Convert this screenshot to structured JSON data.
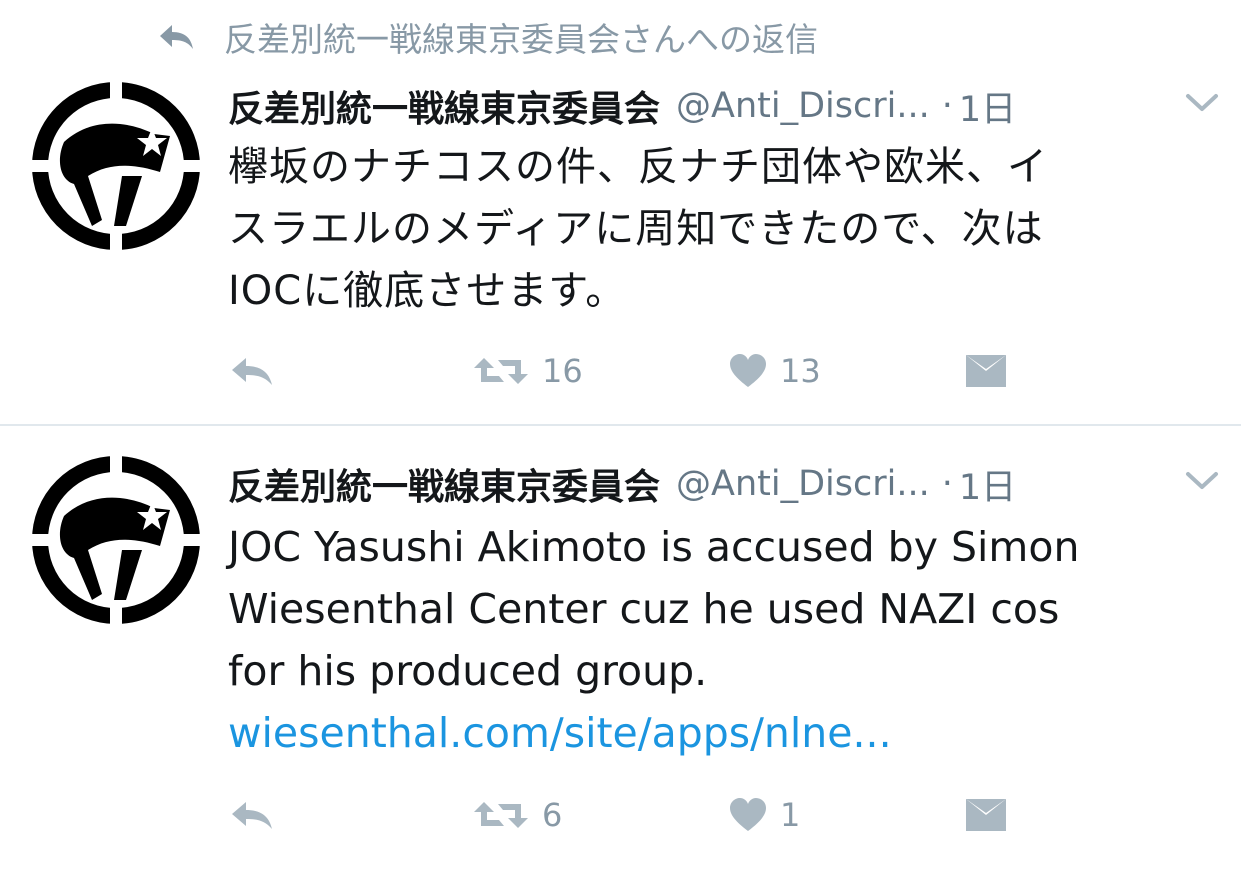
{
  "reply_context": {
    "text": "反差別統一戦線東京委員会さんへの返信",
    "icon": "reply-arrow-icon"
  },
  "colors": {
    "text": "#14171a",
    "secondary": "#657786",
    "icon": "#aab8c2",
    "link": "#1b95e0",
    "divider": "#e1e8ed"
  },
  "tweets": [
    {
      "name": "反差別統一戦線東京委員会",
      "handle": "@Anti_Discri...",
      "dot": "·",
      "time": "1日",
      "body_lines": [
        "欅坂のナチコスの件、反ナチ団体や欧米、イ",
        "スラエルのメディアに周知できたので、次は",
        "IOCに徹底させます。"
      ],
      "link": "",
      "retweets": "16",
      "likes": "13"
    },
    {
      "name": "反差別統一戦線東京委員会",
      "handle": "@Anti_Discri...",
      "dot": "·",
      "time": "1日",
      "body_lines": [
        "JOC Yasushi Akimoto is accused by Simon",
        "Wiesenthal Center cuz he used NAZI cos",
        "for his produced group."
      ],
      "link": "wiesenthal.com/site/apps/nlne...",
      "retweets": "6",
      "likes": "1"
    }
  ]
}
